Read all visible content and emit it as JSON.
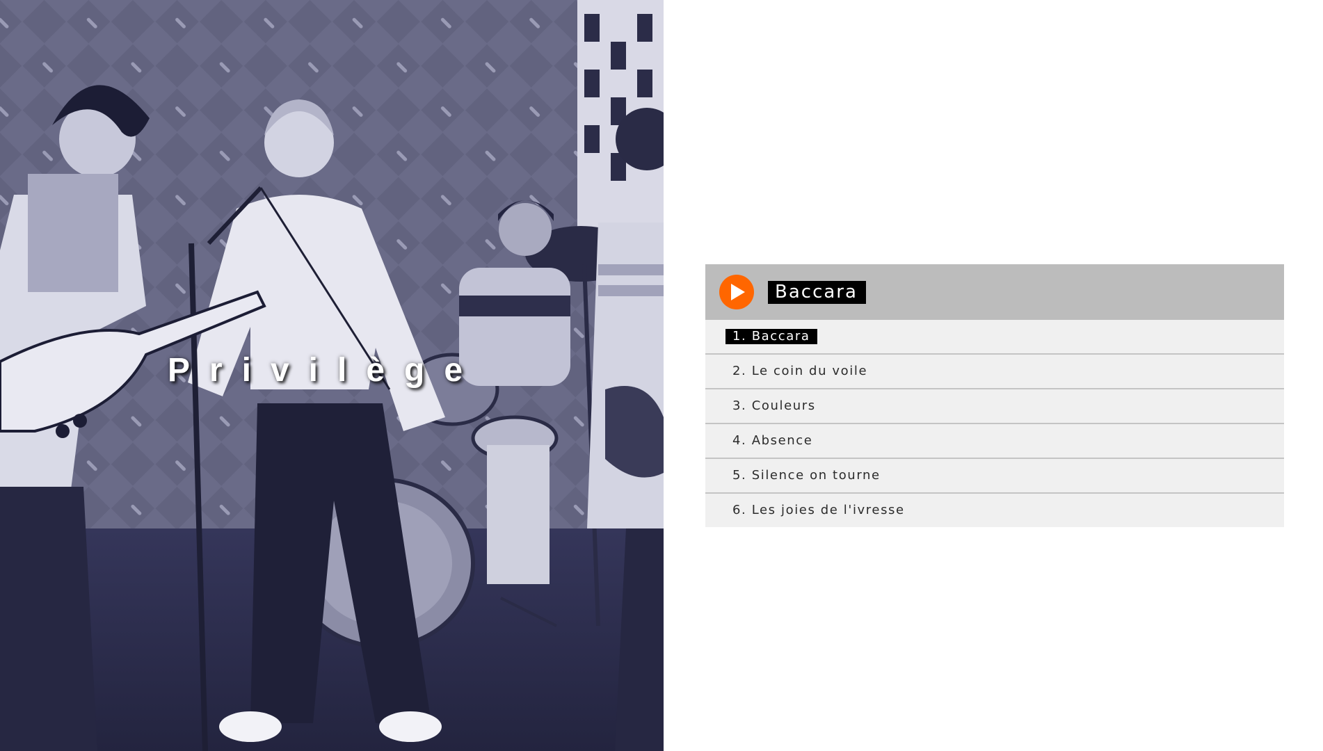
{
  "band": {
    "name": "Privilège",
    "photo_icon": "band-photo"
  },
  "player": {
    "now_playing": "Baccara",
    "play_icon": "play-icon",
    "accent_color": "#ff6600",
    "tracks": [
      {
        "label": "1. Baccara",
        "active": true
      },
      {
        "label": "2. Le coin du voile",
        "active": false
      },
      {
        "label": "3. Couleurs",
        "active": false
      },
      {
        "label": "4. Absence",
        "active": false
      },
      {
        "label": "5. Silence on tourne",
        "active": false
      },
      {
        "label": "6. Les joies de l'ivresse",
        "active": false
      }
    ]
  }
}
